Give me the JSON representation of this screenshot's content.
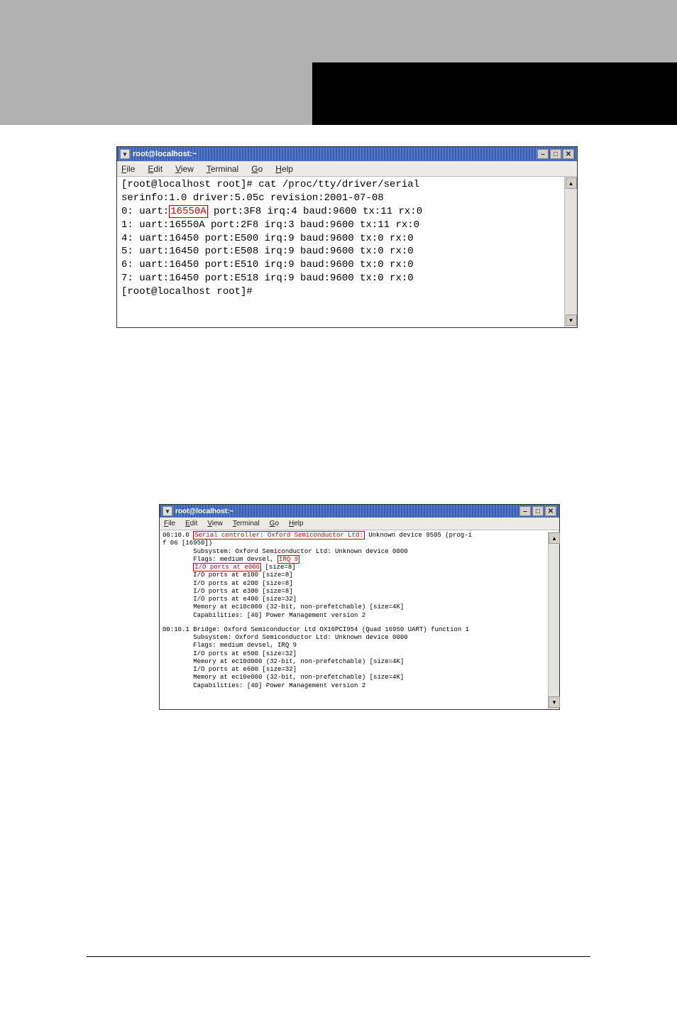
{
  "win1": {
    "title": "root@localhost:~",
    "menubar": [
      "File",
      "Edit",
      "View",
      "Terminal",
      "Go",
      "Help"
    ],
    "lines": {
      "l0": "[root@localhost root]# cat /proc/tty/driver/serial",
      "l1": "serinfo:1.0 driver:5.05c revision:2001-07-08",
      "l2a": "0: uart:",
      "l2b": "16550A",
      "l2c": " port:3F8 irq:4 baud:9600 tx:11 rx:0",
      "l3": "1: uart:16550A port:2F8 irq:3 baud:9600 tx:11 rx:0",
      "l4": "4: uart:16450 port:E500 irq:9 baud:9600 tx:0 rx:0",
      "l5": "5: uart:16450 port:E508 irq:9 baud:9600 tx:0 rx:0",
      "l6": "6: uart:16450 port:E510 irq:9 baud:9600 tx:0 rx:0",
      "l7": "7: uart:16450 port:E518 irq:9 baud:9600 tx:0 rx:0",
      "l8": "[root@localhost root]#"
    }
  },
  "win2": {
    "title": "root@localhost:~",
    "menubar": [
      "File",
      "Edit",
      "View",
      "Terminal",
      "Go",
      "Help"
    ],
    "lines": {
      "l0a": "00:10.0 ",
      "l0b": "Serial controller: Oxford Semiconductor Ltd:",
      "l0c": " Unknown device 9505 (prog-i",
      "l1": "f 06 [16950])",
      "l2": "        Subsystem: Oxford Semiconductor Ltd: Unknown device 0000",
      "l3a": "        Flags: medium devsel, ",
      "l3b": "IRQ 9",
      "l4a": "        ",
      "l4b": "I/O ports at e000",
      "l4c": " [size=8]",
      "l5": "        I/O ports at e100 [size=8]",
      "l6": "        I/O ports at e200 [size=8]",
      "l7": "        I/O ports at e300 [size=8]",
      "l8": "        I/O ports at e400 [size=32]",
      "l9": "        Memory at ec10c000 (32-bit, non-prefetchable) [size=4K]",
      "l10": "        Capabilities: [40] Power Management version 2",
      "l11": "",
      "l12": "00:10.1 Bridge: Oxford Semiconductor Ltd OX16PCI954 (Quad 16950 UART) function 1",
      "l13": "        Subsystem: Oxford Semiconductor Ltd: Unknown device 0000",
      "l14": "        Flags: medium devsel, IRQ 9",
      "l15": "        I/O ports at e500 [size=32]",
      "l16": "        Memory at ec10d000 (32-bit, non-prefetchable) [size=4K]",
      "l17": "        I/O ports at e600 [size=32]",
      "l18": "        Memory at ec10e000 (32-bit, non-prefetchable) [size=4K]",
      "l19": "        Capabilities: [40] Power Management version 2"
    }
  },
  "icons": {
    "minimize": "–",
    "maximize": "□",
    "close": "✕",
    "up": "▴",
    "down": "▾",
    "dd": "▾"
  }
}
